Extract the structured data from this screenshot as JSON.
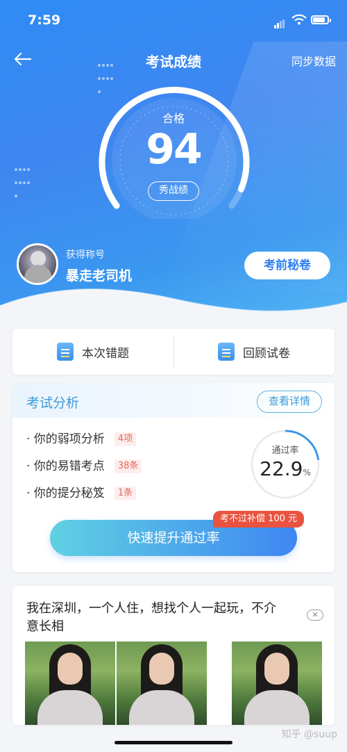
{
  "status_bar": {
    "time": "7:59"
  },
  "nav": {
    "title": "考试成绩",
    "sync_label": "同步数据"
  },
  "score": {
    "label": "合格",
    "value": "94",
    "show_label": "秀战绩"
  },
  "user": {
    "title_label": "获得称号",
    "title_value": "暴走老司机",
    "secret_button": "考前秘卷"
  },
  "actions": [
    {
      "label": "本次错题",
      "icon": "error-list-icon"
    },
    {
      "label": "回顾试卷",
      "icon": "review-paper-icon"
    }
  ],
  "analysis": {
    "title": "考试分析",
    "detail_button": "查看详情",
    "items": [
      {
        "label": "· 你的弱项分析",
        "tag": "4项"
      },
      {
        "label": "· 你的易错考点",
        "tag": "38条"
      },
      {
        "label": "· 你的提分秘笈",
        "tag": "1条"
      }
    ],
    "pass_rate_label": "通过率",
    "pass_rate_value": "22.9",
    "pass_rate_unit": "%",
    "pass_rate_fraction": 0.229,
    "boost_button": "快速提升通过率",
    "compensation_badge": "考不过补偿 100 元"
  },
  "ad": {
    "text": "我在深圳，一个人住，想找个人一起玩，不介意长相",
    "close_label": "✕"
  },
  "watermark": "知乎 @suup",
  "colors": {
    "accent": "#3f86f0",
    "tag_red": "#e46a5a",
    "badge_red": "#e9533f"
  }
}
